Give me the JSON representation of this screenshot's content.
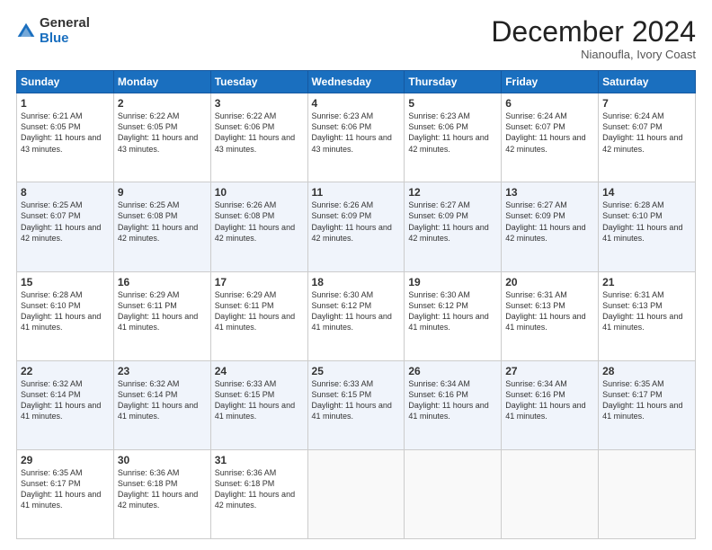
{
  "logo": {
    "line1": "General",
    "line2": "Blue"
  },
  "header": {
    "title": "December 2024",
    "subtitle": "Nianoufla, Ivory Coast"
  },
  "weekdays": [
    "Sunday",
    "Monday",
    "Tuesday",
    "Wednesday",
    "Thursday",
    "Friday",
    "Saturday"
  ],
  "weeks": [
    [
      {
        "day": "1",
        "sunrise": "6:21 AM",
        "sunset": "6:05 PM",
        "daylight": "11 hours and 43 minutes."
      },
      {
        "day": "2",
        "sunrise": "6:22 AM",
        "sunset": "6:05 PM",
        "daylight": "11 hours and 43 minutes."
      },
      {
        "day": "3",
        "sunrise": "6:22 AM",
        "sunset": "6:06 PM",
        "daylight": "11 hours and 43 minutes."
      },
      {
        "day": "4",
        "sunrise": "6:23 AM",
        "sunset": "6:06 PM",
        "daylight": "11 hours and 43 minutes."
      },
      {
        "day": "5",
        "sunrise": "6:23 AM",
        "sunset": "6:06 PM",
        "daylight": "11 hours and 42 minutes."
      },
      {
        "day": "6",
        "sunrise": "6:24 AM",
        "sunset": "6:07 PM",
        "daylight": "11 hours and 42 minutes."
      },
      {
        "day": "7",
        "sunrise": "6:24 AM",
        "sunset": "6:07 PM",
        "daylight": "11 hours and 42 minutes."
      }
    ],
    [
      {
        "day": "8",
        "sunrise": "6:25 AM",
        "sunset": "6:07 PM",
        "daylight": "11 hours and 42 minutes."
      },
      {
        "day": "9",
        "sunrise": "6:25 AM",
        "sunset": "6:08 PM",
        "daylight": "11 hours and 42 minutes."
      },
      {
        "day": "10",
        "sunrise": "6:26 AM",
        "sunset": "6:08 PM",
        "daylight": "11 hours and 42 minutes."
      },
      {
        "day": "11",
        "sunrise": "6:26 AM",
        "sunset": "6:09 PM",
        "daylight": "11 hours and 42 minutes."
      },
      {
        "day": "12",
        "sunrise": "6:27 AM",
        "sunset": "6:09 PM",
        "daylight": "11 hours and 42 minutes."
      },
      {
        "day": "13",
        "sunrise": "6:27 AM",
        "sunset": "6:09 PM",
        "daylight": "11 hours and 42 minutes."
      },
      {
        "day": "14",
        "sunrise": "6:28 AM",
        "sunset": "6:10 PM",
        "daylight": "11 hours and 41 minutes."
      }
    ],
    [
      {
        "day": "15",
        "sunrise": "6:28 AM",
        "sunset": "6:10 PM",
        "daylight": "11 hours and 41 minutes."
      },
      {
        "day": "16",
        "sunrise": "6:29 AM",
        "sunset": "6:11 PM",
        "daylight": "11 hours and 41 minutes."
      },
      {
        "day": "17",
        "sunrise": "6:29 AM",
        "sunset": "6:11 PM",
        "daylight": "11 hours and 41 minutes."
      },
      {
        "day": "18",
        "sunrise": "6:30 AM",
        "sunset": "6:12 PM",
        "daylight": "11 hours and 41 minutes."
      },
      {
        "day": "19",
        "sunrise": "6:30 AM",
        "sunset": "6:12 PM",
        "daylight": "11 hours and 41 minutes."
      },
      {
        "day": "20",
        "sunrise": "6:31 AM",
        "sunset": "6:13 PM",
        "daylight": "11 hours and 41 minutes."
      },
      {
        "day": "21",
        "sunrise": "6:31 AM",
        "sunset": "6:13 PM",
        "daylight": "11 hours and 41 minutes."
      }
    ],
    [
      {
        "day": "22",
        "sunrise": "6:32 AM",
        "sunset": "6:14 PM",
        "daylight": "11 hours and 41 minutes."
      },
      {
        "day": "23",
        "sunrise": "6:32 AM",
        "sunset": "6:14 PM",
        "daylight": "11 hours and 41 minutes."
      },
      {
        "day": "24",
        "sunrise": "6:33 AM",
        "sunset": "6:15 PM",
        "daylight": "11 hours and 41 minutes."
      },
      {
        "day": "25",
        "sunrise": "6:33 AM",
        "sunset": "6:15 PM",
        "daylight": "11 hours and 41 minutes."
      },
      {
        "day": "26",
        "sunrise": "6:34 AM",
        "sunset": "6:16 PM",
        "daylight": "11 hours and 41 minutes."
      },
      {
        "day": "27",
        "sunrise": "6:34 AM",
        "sunset": "6:16 PM",
        "daylight": "11 hours and 41 minutes."
      },
      {
        "day": "28",
        "sunrise": "6:35 AM",
        "sunset": "6:17 PM",
        "daylight": "11 hours and 41 minutes."
      }
    ],
    [
      {
        "day": "29",
        "sunrise": "6:35 AM",
        "sunset": "6:17 PM",
        "daylight": "11 hours and 41 minutes."
      },
      {
        "day": "30",
        "sunrise": "6:36 AM",
        "sunset": "6:18 PM",
        "daylight": "11 hours and 42 minutes."
      },
      {
        "day": "31",
        "sunrise": "6:36 AM",
        "sunset": "6:18 PM",
        "daylight": "11 hours and 42 minutes."
      },
      null,
      null,
      null,
      null
    ]
  ]
}
